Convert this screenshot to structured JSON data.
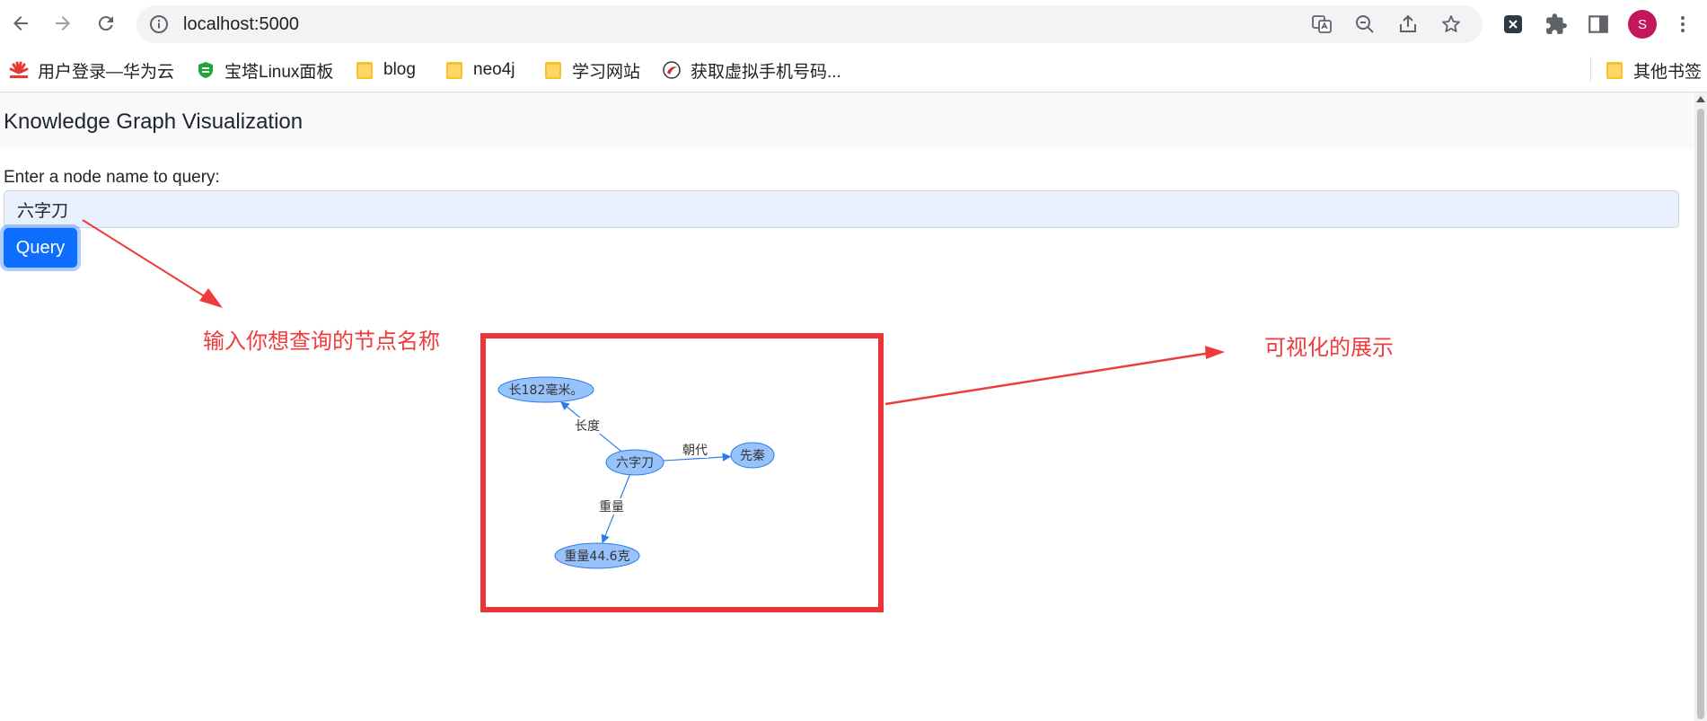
{
  "browser": {
    "url": "localhost:5000",
    "avatar_letter": "S",
    "avatar_color": "#c2185b"
  },
  "bookmarks": [
    {
      "label": "用户登录—华为云",
      "icon": "huawei-logo-icon"
    },
    {
      "label": "宝塔Linux面板",
      "icon": "baota-shield-icon"
    },
    {
      "label": "blog",
      "icon": "folder-icon"
    },
    {
      "label": "neo4j",
      "icon": "folder-icon"
    },
    {
      "label": "学习网站",
      "icon": "folder-icon"
    },
    {
      "label": "获取虚拟手机号码...",
      "icon": "site-favicon-icon"
    }
  ],
  "other_bookmarks": "其他书签",
  "page": {
    "brand": "Knowledge Graph Visualization",
    "label": "Enter a node name to query:",
    "input_value": "六字刀",
    "button_label": "Query"
  },
  "annotations": {
    "input_hint": "输入你想查询的节点名称",
    "graph_hint": "可视化的展示"
  },
  "graph": {
    "nodes": [
      {
        "id": "center",
        "label": "六字刀"
      },
      {
        "id": "length",
        "label": "长182毫米。"
      },
      {
        "id": "dynasty",
        "label": "先秦"
      },
      {
        "id": "weight",
        "label": "重量44.6克"
      }
    ],
    "edges": [
      {
        "from": "center",
        "to": "length",
        "label": "长度"
      },
      {
        "from": "center",
        "to": "dynasty",
        "label": "朝代"
      },
      {
        "from": "center",
        "to": "weight",
        "label": "重量"
      }
    ],
    "node_fill": "#97c2fc",
    "node_stroke": "#2b7ce9",
    "edge_color": "#2b7ce9"
  },
  "colors": {
    "accent": "#0d6efd",
    "annotation_red": "#ef3b3b"
  }
}
